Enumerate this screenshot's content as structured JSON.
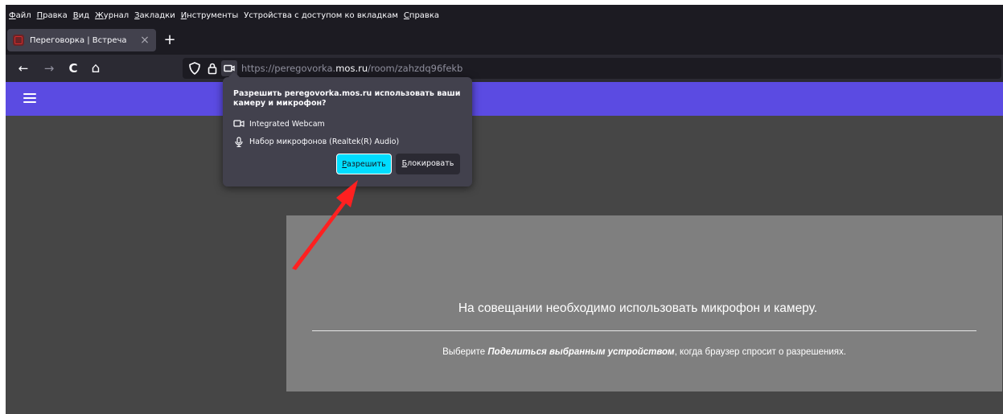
{
  "menu": [
    {
      "label": "Файл",
      "accel": "Ф",
      "rest": "айл"
    },
    {
      "label": "Правка",
      "accel": "П",
      "rest": "равка"
    },
    {
      "label": "Вид",
      "accel": "В",
      "rest": "ид"
    },
    {
      "label": "Журнал",
      "accel": "Ж",
      "rest": "урнал"
    },
    {
      "label": "Закладки",
      "accel": "З",
      "rest": "акладки"
    },
    {
      "label": "Инструменты",
      "accel": "И",
      "rest": "нструменты"
    },
    {
      "label": "Устройства с доступом ко вкладкам",
      "accel": "",
      "rest": "Устройства с доступом ко вкладкам"
    },
    {
      "label": "Справка",
      "accel": "С",
      "rest": "правка"
    }
  ],
  "tab": {
    "title": "Переговорка | Встреча",
    "close_glyph": "×"
  },
  "newtab_glyph": "+",
  "nav": {
    "back": "←",
    "forward": "→",
    "reload": "C",
    "home": "⌂"
  },
  "url": {
    "scheme_host_prefix": "https://peregovorka.",
    "domain": "mos.ru",
    "path": "/room/zahzdq96fekb"
  },
  "popup": {
    "message": "Разрешить peregovorka.mos.ru использовать ваши камеру и микрофон?",
    "camera": "Integrated Webcam",
    "microphone": "Набор микрофонов (Realtek(R) Audio)",
    "allow": {
      "accel": "Р",
      "rest": "азрешить"
    },
    "block": {
      "accel": "Б",
      "rest": "локировать"
    }
  },
  "card": {
    "title": "На совещании необходимо использовать микрофон и камеру.",
    "sub_before": "Выберите ",
    "sub_bold": "Поделиться выбранным устройством",
    "sub_after": ", когда браузер спросит о разрешениях."
  },
  "colors": {
    "accent_bar": "#5b4be2",
    "allow_button": "#00ddff",
    "popup_bg": "#42414d",
    "annotation_arrow": "#ff2020"
  }
}
